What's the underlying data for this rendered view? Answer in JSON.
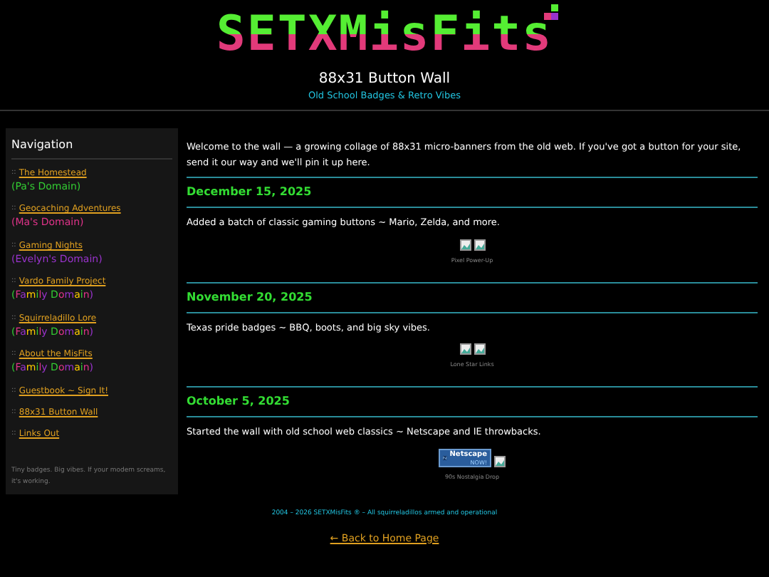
{
  "header": {
    "logo": "SETXMisFits",
    "title": "88x31 Button Wall",
    "tagline": "Old School Badges & Retro Vibes"
  },
  "sidebar": {
    "title": "Navigation",
    "bullet": "::",
    "items": [
      {
        "label": "The Homestead",
        "sub": "(Pa's Domain)",
        "kind": "single",
        "color": "#33cc33"
      },
      {
        "label": "Geocaching Adventures",
        "sub": "(Ma's Domain)",
        "kind": "single",
        "color": "#e0338a"
      },
      {
        "label": "Gaming Nights",
        "sub": "(Evelyn's Domain)",
        "kind": "single",
        "color": "#9933cc"
      },
      {
        "label": "Vardo Family Project",
        "sub": "(Family Domain)",
        "kind": "rainbow"
      },
      {
        "label": "Squirreladillo Lore",
        "sub": "(Family Domain)",
        "kind": "rainbow"
      },
      {
        "label": "About the MisFits",
        "sub": "(Family Domain)",
        "kind": "rainbow"
      },
      {
        "label": "Guestbook ~ Sign It!",
        "kind": "plain"
      },
      {
        "label": "88x31 Button Wall",
        "kind": "plain"
      },
      {
        "label": "Links Out",
        "kind": "plain"
      }
    ],
    "note": "Tiny badges. Big vibes. If your modem screams, it's working."
  },
  "intro": "Welcome to the wall — a growing collage of 88x31 micro-banners from the old web. If you've got a button for your site, send it our way and we'll pin it up here.",
  "posts": [
    {
      "date": "December 15, 2025",
      "text": "Added a batch of classic gaming buttons ~ Mario, Zelda, and more.",
      "badges": [
        {
          "kind": "broken"
        },
        {
          "kind": "broken"
        }
      ],
      "caption": "Pixel Power-Up"
    },
    {
      "date": "November 20, 2025",
      "text": "Texas pride badges ~ BBQ, boots, and big sky vibes.",
      "badges": [
        {
          "kind": "broken"
        },
        {
          "kind": "broken"
        }
      ],
      "caption": "Lone Star Links"
    },
    {
      "date": "October 5, 2025",
      "text": "Started the wall with old school web classics ~ Netscape and IE throwbacks.",
      "badges": [
        {
          "kind": "netscape",
          "line1": "Netscape",
          "line2": "NOW!"
        },
        {
          "kind": "broken"
        }
      ],
      "caption": "90s Nostalgia Drop"
    }
  ],
  "footer": {
    "copyright": "2004 – 2026 SETXMisFits ® – All squirreladillos armed and operational",
    "back_link": "← Back to Home Page"
  }
}
